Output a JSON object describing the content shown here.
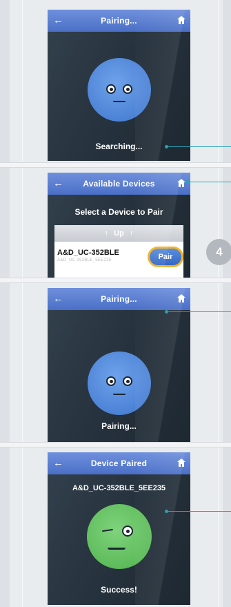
{
  "screens": {
    "searching": {
      "title": "Pairing...",
      "status": "Searching..."
    },
    "available": {
      "title": "Available Devices",
      "prompt": "Select a Device to Pair",
      "up_label": "Up",
      "device_name": "A&D_UC-352BLE",
      "device_detail": "A&D_UC-352BLE_5EE235",
      "pair_label": "Pair"
    },
    "pairing": {
      "title": "Pairing...",
      "status": "Pairing..."
    },
    "paired": {
      "title": "Device Paired",
      "device": "A&D_UC-352BLE_5EE235",
      "status": "Success!"
    }
  },
  "step_number": "4",
  "icons": {
    "back": "back-arrow-icon",
    "home": "home-icon",
    "up": "up-arrow-icon"
  },
  "colors": {
    "header": "#5a7fd2",
    "face_blue": "#5b8fde",
    "face_green": "#63c060",
    "pair_border": "#f2b327",
    "callout": "#28a2b6"
  }
}
